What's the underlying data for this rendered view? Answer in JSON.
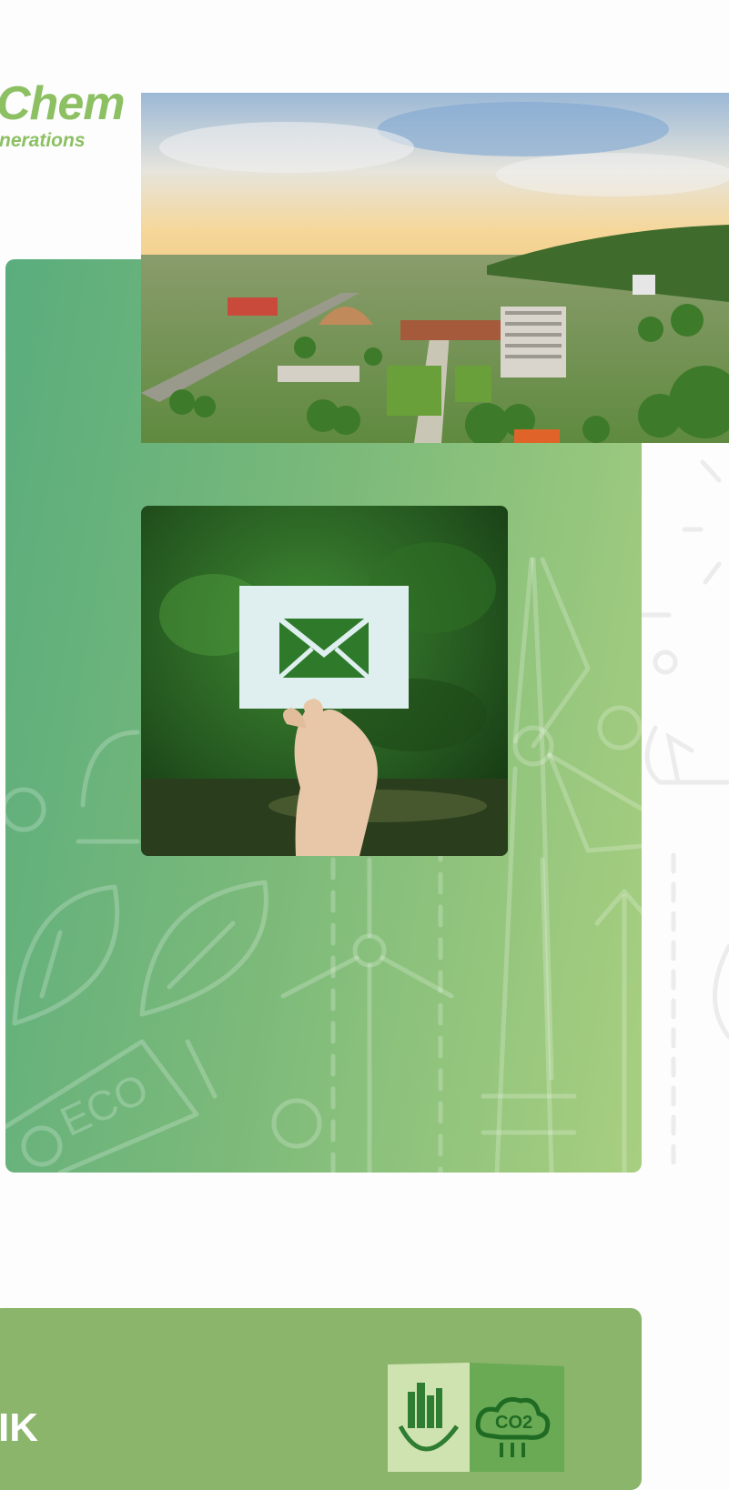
{
  "logo": {
    "name": "Chem",
    "tagline": "nerations"
  },
  "section": {
    "title": "IK"
  },
  "images": {
    "factory": "industrial-plant-aerial-photo",
    "mail": "hand-holding-envelope-photo",
    "cube": "eco-cube-co2-image"
  },
  "cube_labels": {
    "co2": "CO2"
  },
  "decor": {
    "eco_label": "ECO"
  },
  "colors": {
    "brand_green": "#8cc063",
    "card_gradient_start": "#5aad7d",
    "card_gradient_end": "#a8cf80",
    "bottom_card": "#8ab56a"
  }
}
